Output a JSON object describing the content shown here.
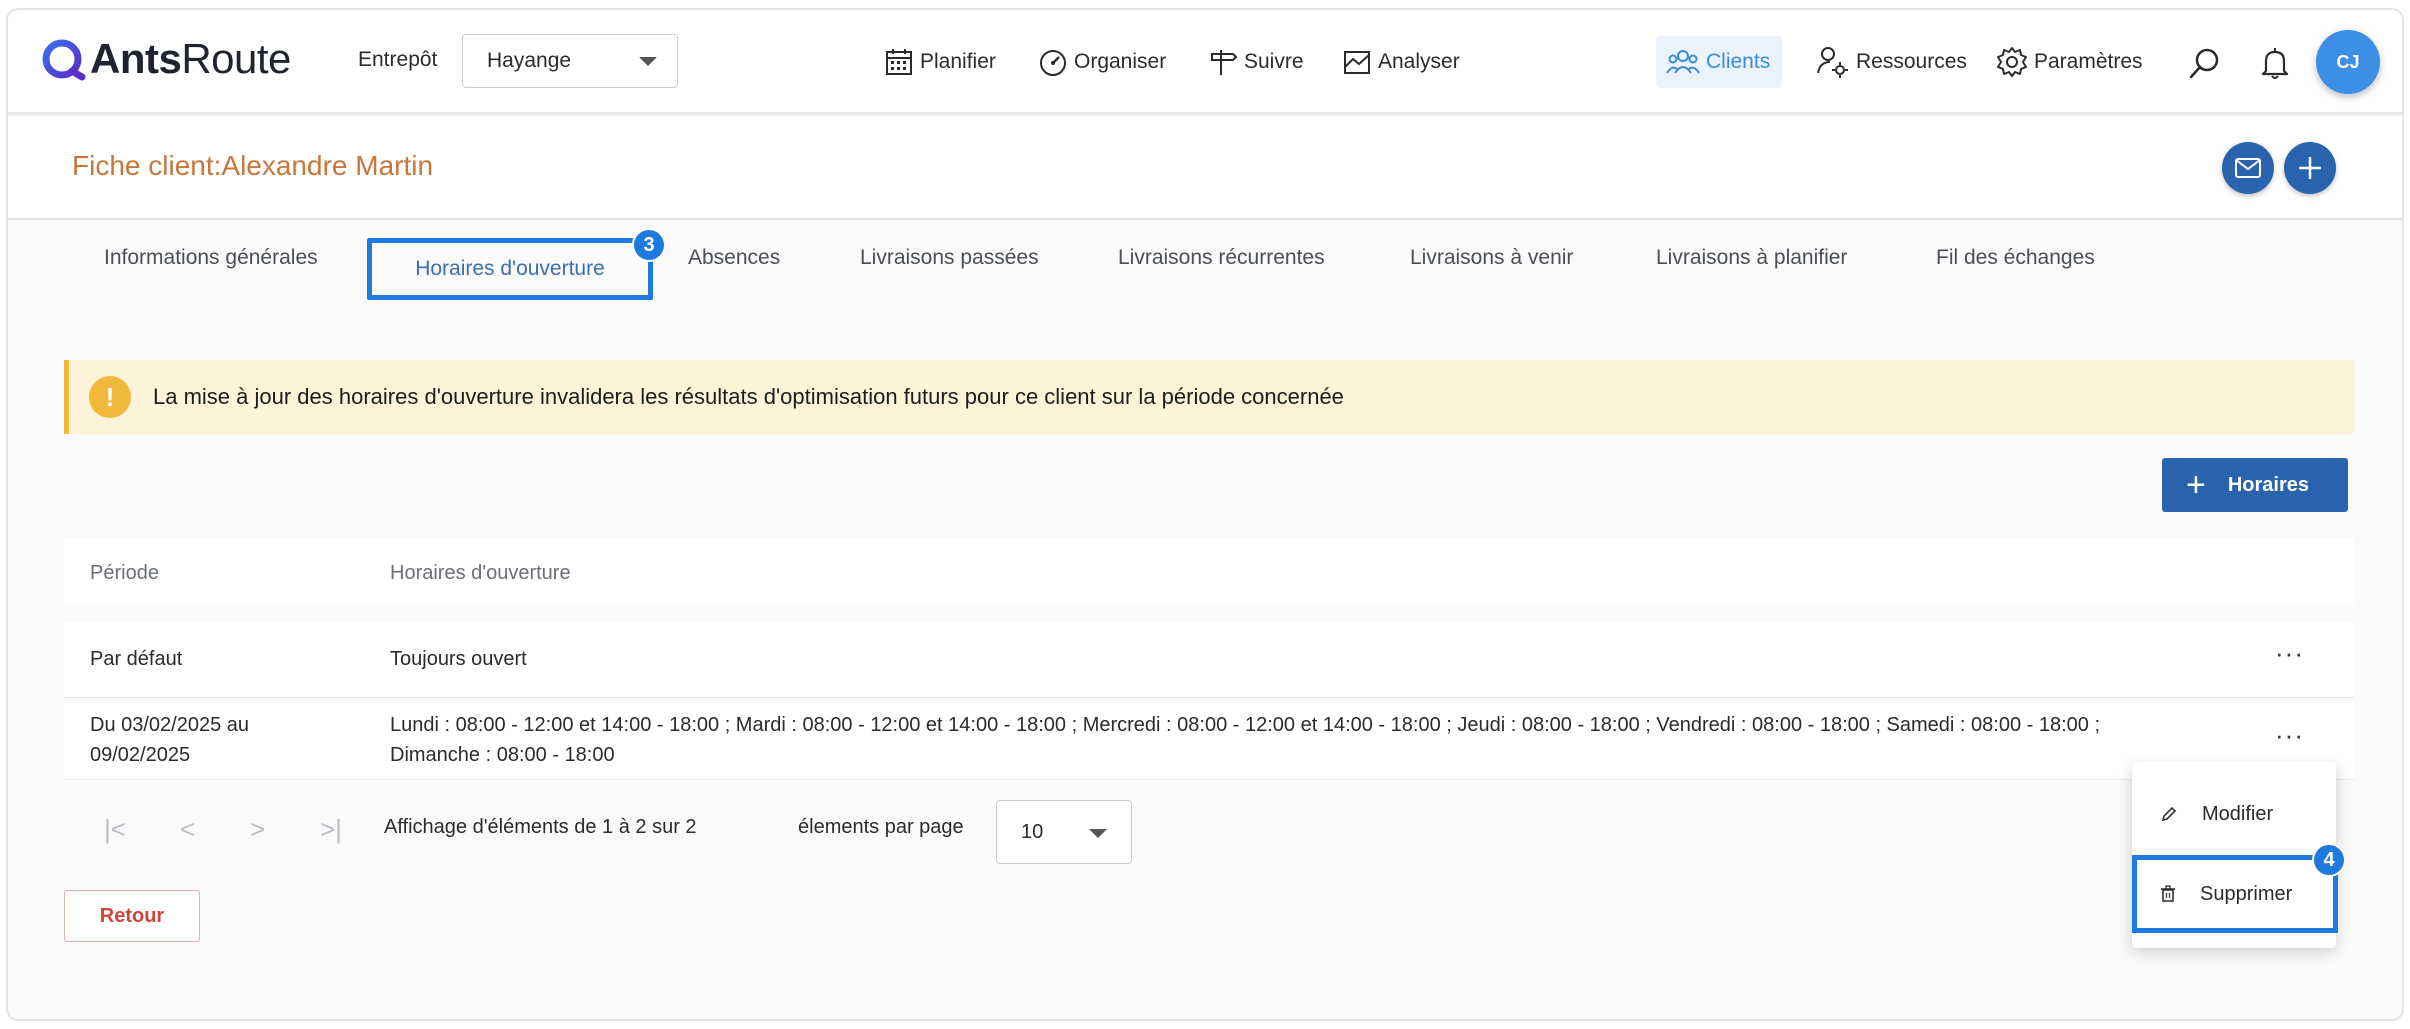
{
  "header": {
    "logo": {
      "bold": "Ants",
      "light": "Route"
    },
    "warehouse_label": "Entrepôt",
    "warehouse_value": "Hayange",
    "nav": [
      {
        "label": "Planifier",
        "icon": "calendar-icon"
      },
      {
        "label": "Organiser",
        "icon": "gauge-icon"
      },
      {
        "label": "Suivre",
        "icon": "signpost-icon"
      },
      {
        "label": "Analyser",
        "icon": "chart-icon"
      }
    ],
    "right_nav": [
      {
        "label": "Clients",
        "icon": "users-icon",
        "active": true
      },
      {
        "label": "Ressources",
        "icon": "user-gear-icon"
      },
      {
        "label": "Paramètres",
        "icon": "gear-icon"
      }
    ],
    "avatar_initials": "CJ"
  },
  "client": {
    "title": "Fiche client:Alexandre Martin"
  },
  "tabs": [
    "Informations générales",
    "Horaires d'ouverture",
    "Absences",
    "Livraisons passées",
    "Livraisons récurrentes",
    "Livraisons à venir",
    "Livraisons à planifier",
    "Fil des échanges"
  ],
  "step_badges": {
    "tab": "3",
    "menu": "4"
  },
  "warning": {
    "icon": "!",
    "text": "La mise à jour des horaires d'ouverture invalidera les résultats d'optimisation futurs pour ce client sur la période concernée"
  },
  "add_button": {
    "plus": "+",
    "label": "Horaires"
  },
  "table": {
    "columns": [
      "Période",
      "Horaires d'ouverture"
    ],
    "rows": [
      {
        "period": "Par défaut",
        "period2": "",
        "hours": "Toujours ouvert",
        "hours2": "",
        "actions": "···"
      },
      {
        "period": "Du 03/02/2025 au",
        "period2": "09/02/2025",
        "hours": "Lundi : 08:00 - 12:00 et 14:00 - 18:00 ; Mardi : 08:00 - 12:00 et 14:00 - 18:00 ; Mercredi : 08:00 - 12:00 et 14:00 - 18:00 ; Jeudi : 08:00 - 18:00 ; Vendredi : 08:00 - 18:00 ; Samedi : 08:00 - 18:00 ;",
        "hours2": "Dimanche : 08:00 - 18:00",
        "actions": "···"
      }
    ]
  },
  "pagination": {
    "first": "|<",
    "prev": "<",
    "next": ">",
    "last": ">|",
    "summary": "Affichage d'éléments de 1 à 2 sur 2",
    "per_page_label": "élements par page",
    "per_page_value": "10"
  },
  "back_button": "Retour",
  "context_menu": {
    "items": [
      {
        "label": "Modifier",
        "icon": "pencil-icon"
      },
      {
        "label": "Supprimer",
        "icon": "trash-icon"
      }
    ]
  },
  "colors": {
    "primary": "#2a63ad",
    "highlight": "#1f7ae0",
    "title_orange": "#c8763c",
    "warning_bg": "#fdf3d9",
    "warning_accent": "#f1b93c"
  }
}
